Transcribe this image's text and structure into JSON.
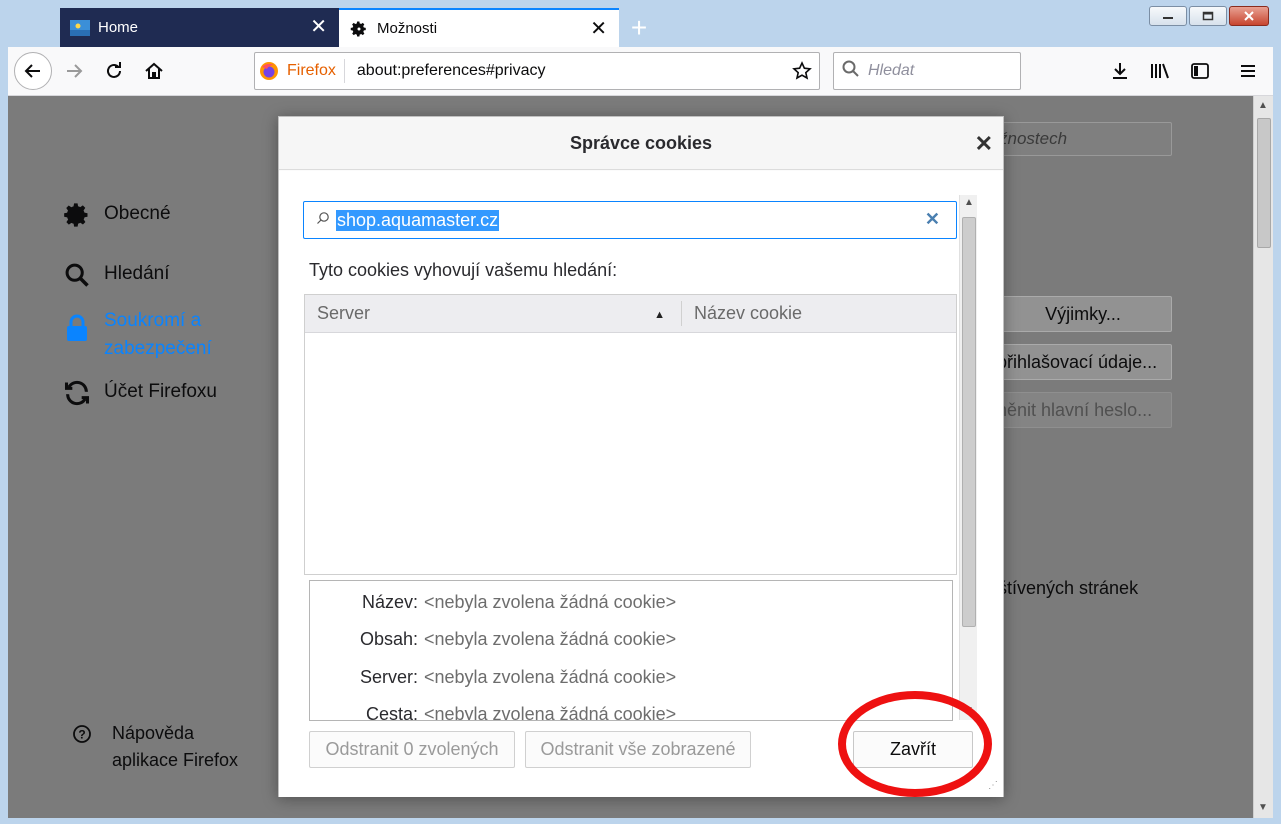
{
  "tabs": [
    {
      "title": "Home",
      "active": false
    },
    {
      "title": "Možnosti",
      "active": true
    }
  ],
  "navbar": {
    "identity_label": "Firefox",
    "url": "about:preferences#privacy",
    "search_placeholder": "Hledat"
  },
  "sidebar": {
    "items": [
      {
        "label": "Obecné",
        "icon": "gear-icon"
      },
      {
        "label": "Hledání",
        "icon": "search-icon"
      },
      {
        "label_line1": "Soukromí a",
        "label_line2": "zabezpečení",
        "icon": "lock-icon",
        "selected": true
      },
      {
        "label": "Účet Firefoxu",
        "icon": "sync-icon"
      }
    ],
    "help_line1": "Nápověda",
    "help_line2": "aplikace Firefox"
  },
  "background": {
    "find_placeholder_fragment": "žnostech",
    "exceptions_button": "Výjimky...",
    "logins_button": "přihlašovací údaje...",
    "master_password_button": "něnit hlavní heslo...",
    "visited_text": "štívených stránek"
  },
  "dialog": {
    "title": "Správce cookies",
    "search_value": "shop.aquamaster.cz",
    "match_label": "Tyto cookies vyhovují vašemu hledání:",
    "columns": {
      "server": "Server",
      "cookie_name": "Název cookie"
    },
    "rows": [],
    "details": [
      {
        "label": "Název:",
        "value": "<nebyla zvolena žádná cookie>"
      },
      {
        "label": "Obsah:",
        "value": "<nebyla zvolena žádná cookie>"
      },
      {
        "label": "Server:",
        "value": "<nebyla zvolena žádná cookie>"
      },
      {
        "label": "Cesta:",
        "value": "<nebyla zvolena žádná cookie>"
      }
    ],
    "remove_selected_button": "Odstranit 0 zvolených",
    "remove_all_button": "Odstranit vše zobrazené",
    "close_button": "Zavřít"
  },
  "colors": {
    "accent": "#0a84ff",
    "highlight": "#ee1111",
    "tab_inactive_bg": "#1f2b52"
  }
}
